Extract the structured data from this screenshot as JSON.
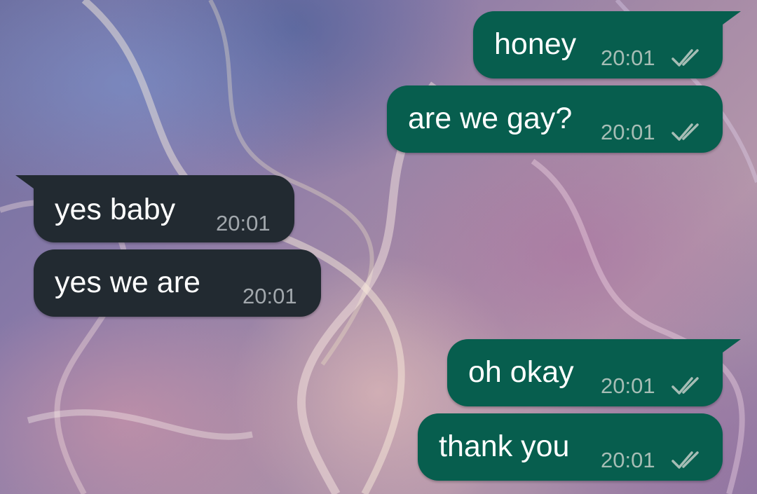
{
  "colors": {
    "outgoing_bubble": "#075e4e",
    "incoming_bubble": "#222a31",
    "outgoing_time": "#a6bdb5",
    "incoming_time": "#a2a8ad",
    "tick_color": "#a6bdb5"
  },
  "messages": [
    {
      "direction": "outgoing",
      "text": "honey",
      "time": "20:01",
      "status_icon": "double-check-icon"
    },
    {
      "direction": "outgoing",
      "text": "are we gay?",
      "time": "20:01",
      "status_icon": "double-check-icon"
    },
    {
      "direction": "incoming",
      "text": "yes baby",
      "time": "20:01"
    },
    {
      "direction": "incoming",
      "text": "yes we are",
      "time": "20:01"
    },
    {
      "direction": "outgoing",
      "text": "oh okay",
      "time": "20:01",
      "status_icon": "double-check-icon"
    },
    {
      "direction": "outgoing",
      "text": "thank you",
      "time": "20:01",
      "status_icon": "double-check-icon"
    }
  ]
}
